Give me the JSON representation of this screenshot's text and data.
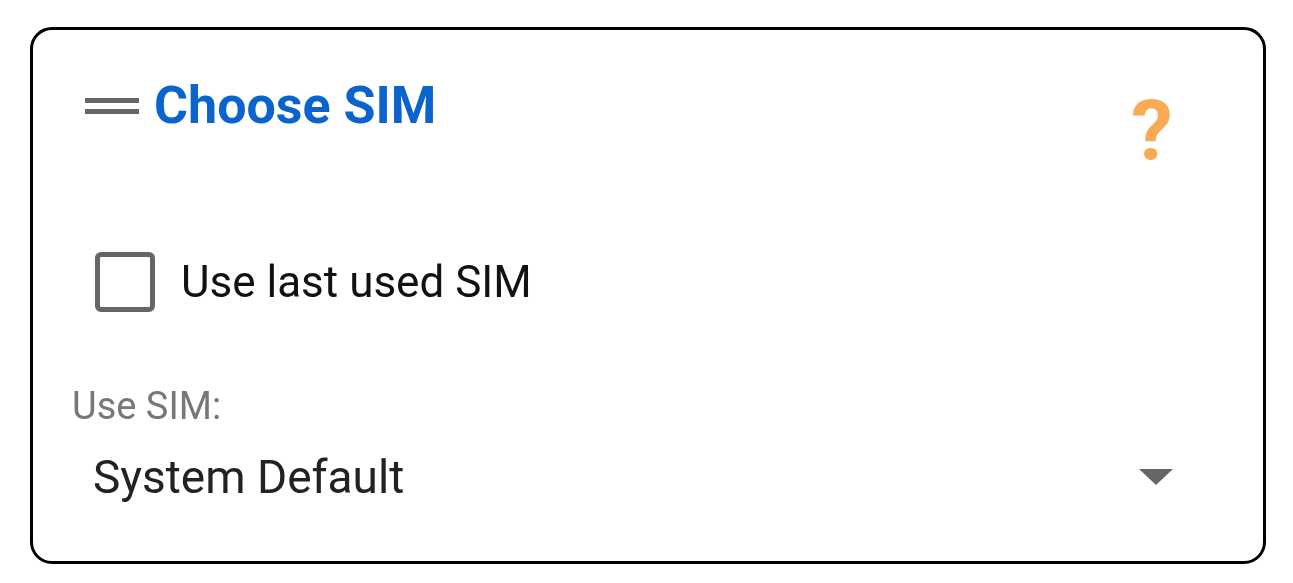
{
  "card": {
    "title": "Choose SIM",
    "help_glyph": "?"
  },
  "checkbox": {
    "label": "Use last used SIM",
    "checked": false
  },
  "sim_select": {
    "label": "Use SIM:",
    "value": "System Default"
  }
}
